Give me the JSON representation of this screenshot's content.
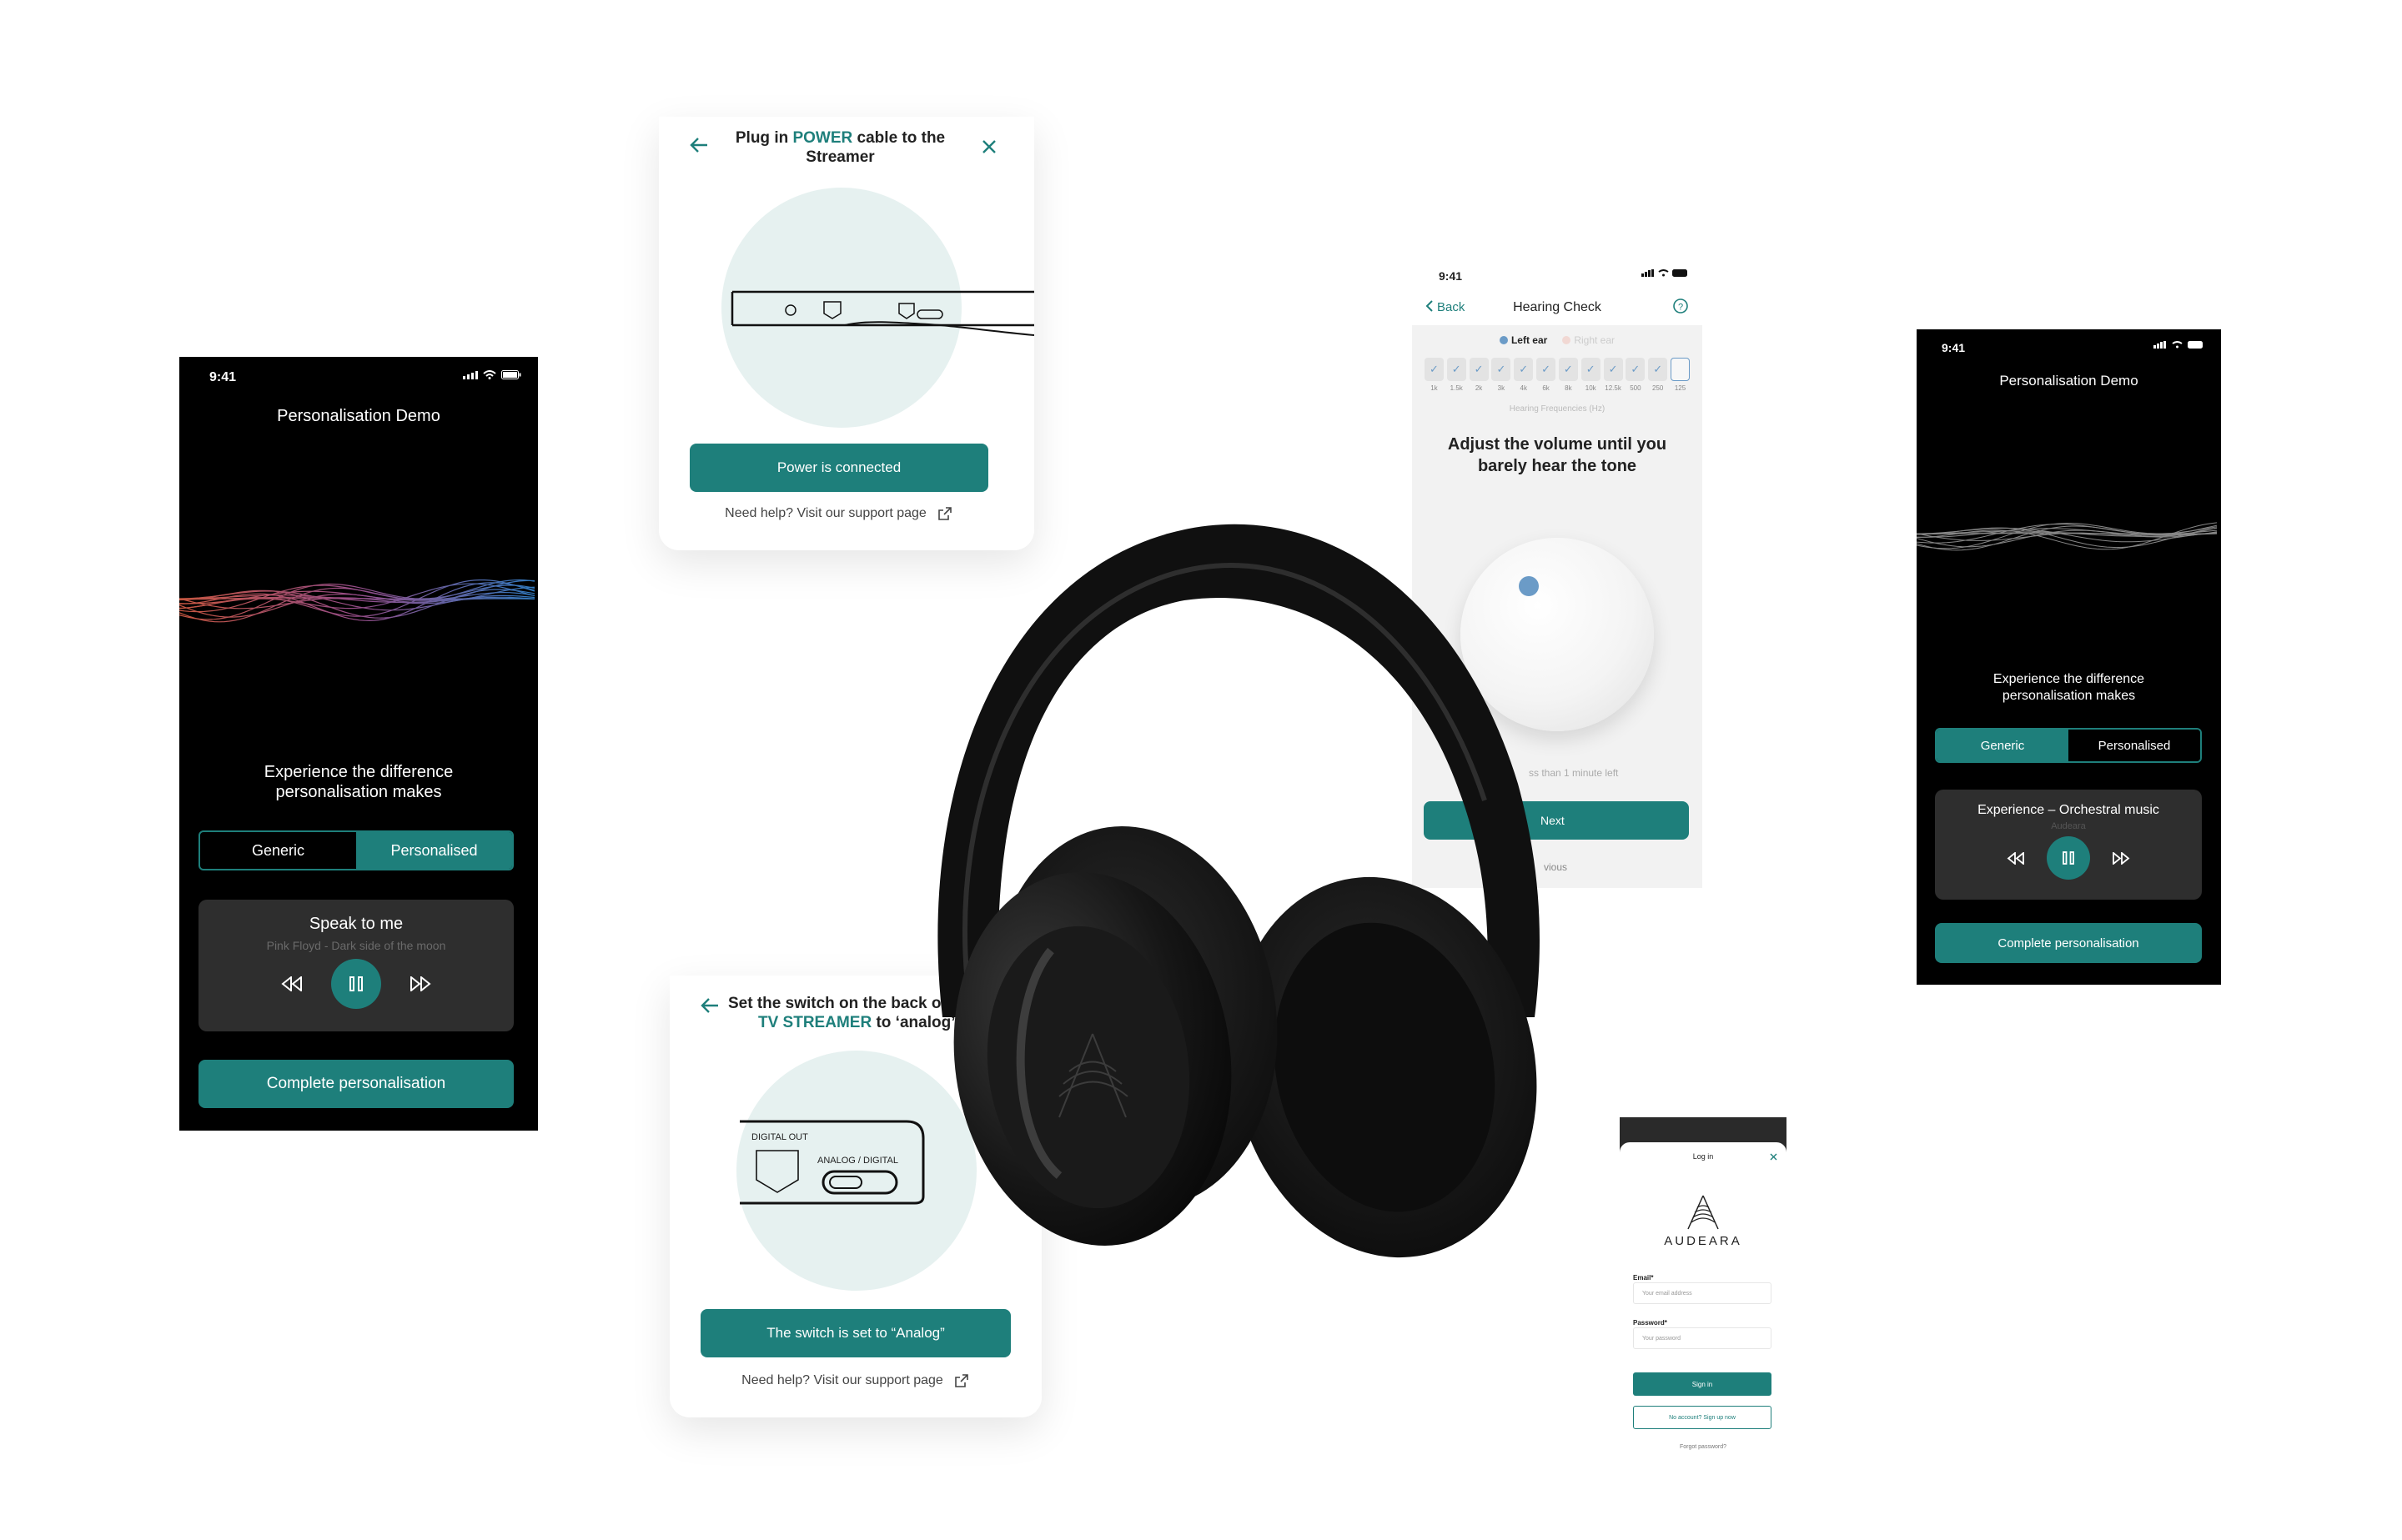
{
  "left_phone": {
    "time": "9:41",
    "title": "Personalisation Demo",
    "tagline": "Experience the difference personalisation makes",
    "seg_generic": "Generic",
    "seg_personalised": "Personalised",
    "track_title": "Speak to me",
    "track_sub": "Pink Floyd - Dark side of the moon",
    "complete_btn": "Complete personalisation"
  },
  "power_card": {
    "title_pre": "Plug in ",
    "title_hl": "POWER",
    "title_post": " cable to the Streamer",
    "button": "Power is connected",
    "help": "Need help? Visit our support page"
  },
  "switch_card": {
    "title_line1": "Set the switch on the back of th",
    "title_hl": "TV STREAMER",
    "title_post": " to ‘analog’",
    "label_digital": "DIGITAL OUT",
    "label_analog": "ANALOG / DIGITAL",
    "button": "The switch is set to “Analog”",
    "help": "Need help? Visit our support page"
  },
  "hearing": {
    "time": "9:41",
    "back": "Back",
    "title": "Hearing Check",
    "left_ear": "Left ear",
    "right_ear": "Right ear",
    "freqs": [
      "1k",
      "1.5k",
      "2k",
      "3k",
      "4k",
      "6k",
      "8k",
      "10k",
      "12.5k",
      "500",
      "250",
      "125"
    ],
    "freq_caption": "Hearing Frequencies (Hz)",
    "instruction": "Adjust the volume until you barely hear the tone",
    "time_left": "ss than 1 minute left",
    "next": "Next",
    "previous": "vious"
  },
  "right_phone": {
    "time": "9:41",
    "title": "Personalisation Demo",
    "tagline": "Experience the difference personalisation makes",
    "seg_generic": "Generic",
    "seg_personalised": "Personalised",
    "track_title": "Experience – Orchestral music",
    "track_sub": "Audeara",
    "complete_btn": "Complete personalisation"
  },
  "login": {
    "title": "Log in",
    "brand": "AUDEARA",
    "email_label": "Email*",
    "email_placeholder": "Your email address",
    "password_label": "Password*",
    "password_placeholder": "Your password",
    "sign_in": "Sign in",
    "signup": "No account? Sign up now",
    "forgot": "Forgot password?"
  },
  "colors": {
    "accent": "#1e7f7b",
    "dark": "#000000",
    "card_circle": "#e6f1f0"
  }
}
